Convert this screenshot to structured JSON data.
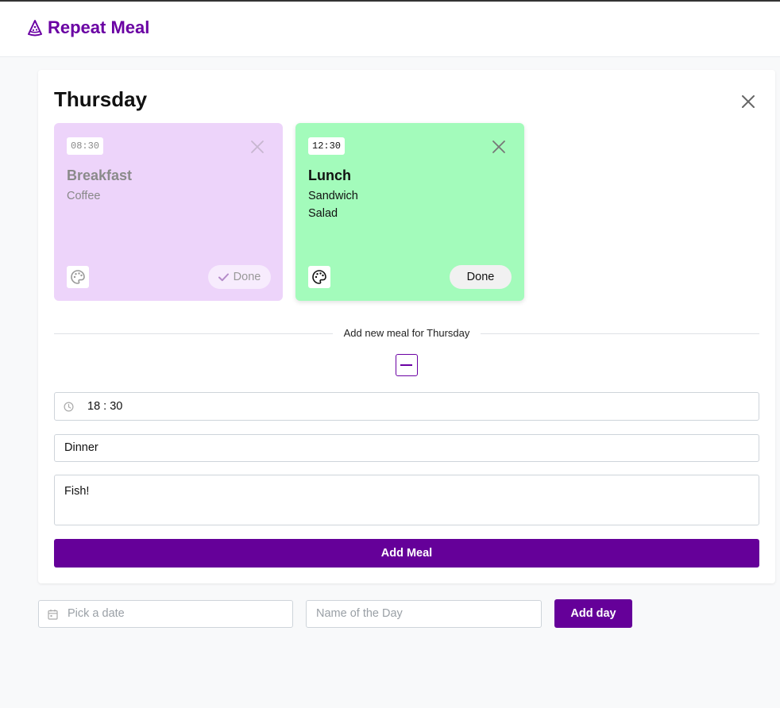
{
  "app": {
    "title": "Repeat Meal",
    "logo_icon": "pizza-slice-icon",
    "brand_color": "#6a00a3"
  },
  "day": {
    "title": "Thursday",
    "close_icon": "close-icon"
  },
  "meals": [
    {
      "time": "08:30",
      "name": "Breakfast",
      "items": [
        "Coffee"
      ],
      "done_label": "Done",
      "done": true,
      "background": "#edd4fa"
    },
    {
      "time": "12:30",
      "name": "Lunch",
      "items": [
        "Sandwich",
        "Salad"
      ],
      "done_label": "Done",
      "done": false,
      "background": "#a3fbbb"
    }
  ],
  "new_meal": {
    "divider_label": "Add new meal for Thursday",
    "time_value": "18 : 30",
    "name_value": "Dinner",
    "description_value": "Fish!",
    "submit_label": "Add Meal"
  },
  "add_day": {
    "date_placeholder": "Pick a date",
    "name_placeholder": "Name of the Day",
    "submit_label": "Add day"
  }
}
